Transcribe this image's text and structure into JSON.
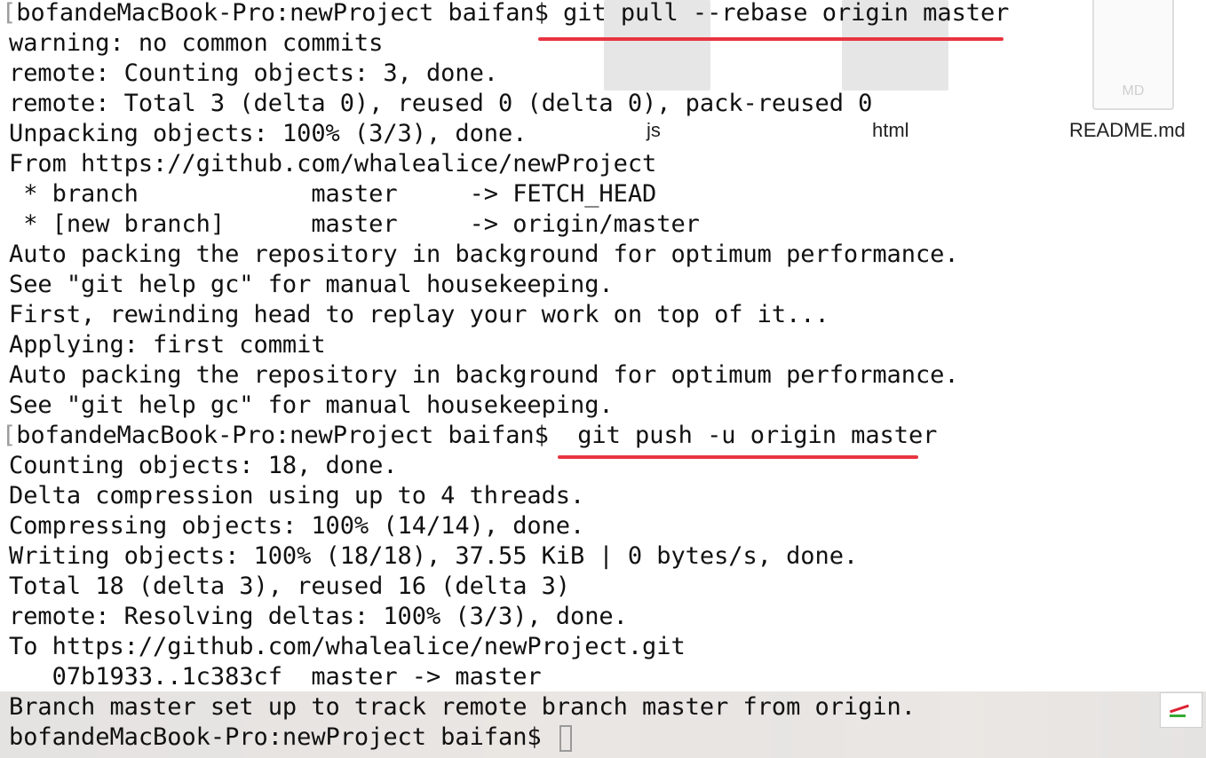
{
  "background": {
    "folders": [
      "js",
      "html"
    ],
    "file": {
      "name": "README.md",
      "badge": "MD"
    }
  },
  "terminal": {
    "lines": [
      "bofandeMacBook-Pro:newProject baifan$ git pull --rebase origin master",
      "warning: no common commits",
      "remote: Counting objects: 3, done.",
      "remote: Total 3 (delta 0), reused 0 (delta 0), pack-reused 0",
      "Unpacking objects: 100% (3/3), done.",
      "From https://github.com/whalealice/newProject",
      " * branch            master     -> FETCH_HEAD",
      " * [new branch]      master     -> origin/master",
      "Auto packing the repository in background for optimum performance.",
      "See \"git help gc\" for manual housekeeping.",
      "First, rewinding head to replay your work on top of it...",
      "Applying: first commit",
      "Auto packing the repository in background for optimum performance.",
      "See \"git help gc\" for manual housekeeping.",
      "bofandeMacBook-Pro:newProject baifan$  git push -u origin master",
      "Counting objects: 18, done.",
      "Delta compression using up to 4 threads.",
      "Compressing objects: 100% (14/14), done.",
      "Writing objects: 100% (18/18), 37.55 KiB | 0 bytes/s, done.",
      "Total 18 (delta 3), reused 16 (delta 3)",
      "remote: Resolving deltas: 100% (3/3), done.",
      "To https://github.com/whalealice/newProject.git",
      "   07b1933..1c383cf  master -> master",
      "Branch master set up to track remote branch master from origin.",
      "bofandeMacBook-Pro:newProject baifan$ "
    ]
  },
  "colors": {
    "text": "#111111",
    "annotation_underline": "#e8343f"
  }
}
